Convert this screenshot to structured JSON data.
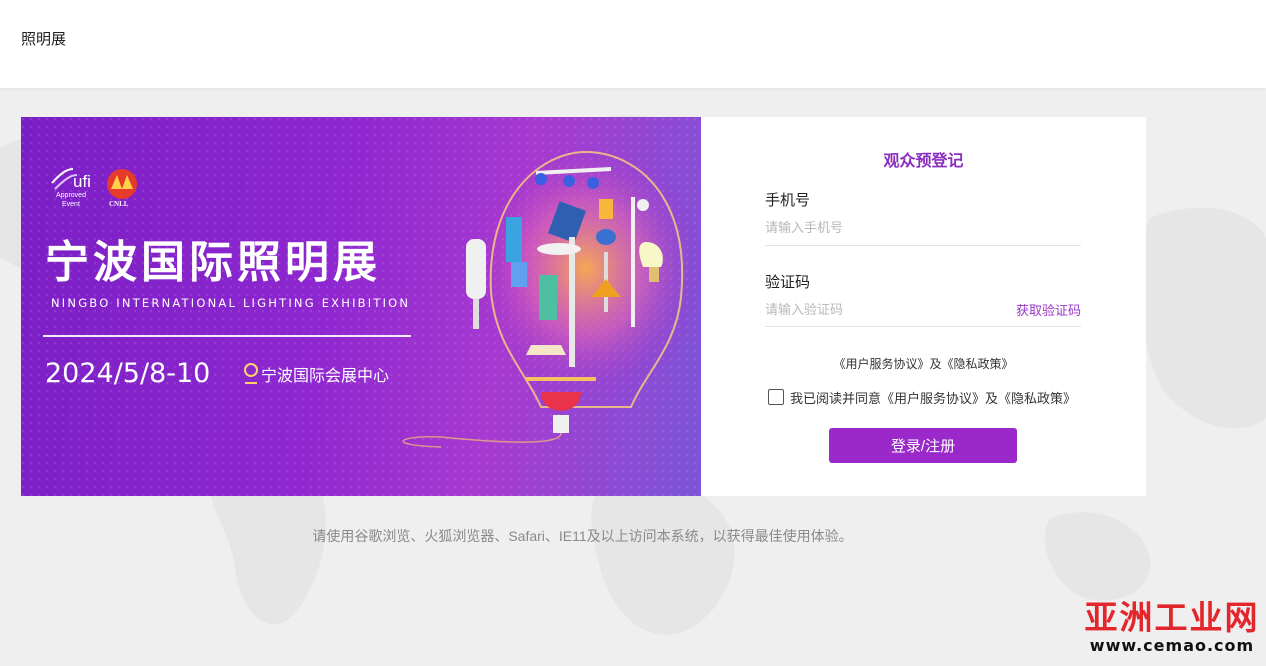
{
  "header": {
    "site_title": "照明展"
  },
  "banner": {
    "logo_ufi": "ufi",
    "logo_ufi_sub1": "Approved",
    "logo_ufi_sub2": "Event",
    "logo_cnll": "CNLL",
    "title_cn": "宁波国际照明展",
    "title_en": "NINGBO INTERNATIONAL LIGHTING EXHIBITION",
    "date": "2024/5/8-10",
    "venue": "宁波国际会展中心"
  },
  "form": {
    "title": "观众预登记",
    "phone_label": "手机号",
    "phone_placeholder": "请输入手机号",
    "phone_value": "",
    "code_label": "验证码",
    "code_placeholder": "请输入验证码",
    "code_value": "",
    "get_code_label": "获取验证码",
    "agreements_line": "《用户服务协议》及《隐私政策》",
    "agree_text": "我已阅读并同意《用户服务协议》及《隐私政策》",
    "agree_checked": false,
    "submit_label": "登录/注册"
  },
  "footer": {
    "browser_note": "请使用谷歌浏览、火狐浏览器、Safari、IE11及以上访问本系统，以获得最佳使用体验。"
  },
  "watermark": {
    "name": "亚洲工业网",
    "url": "www.cemao.com"
  },
  "colors": {
    "accent": "#9b28c9",
    "title_purple": "#8a2ec0",
    "banner_purple": "#8e27cf",
    "page_bg": "#efefef",
    "watermark_red": "#e3262b"
  }
}
